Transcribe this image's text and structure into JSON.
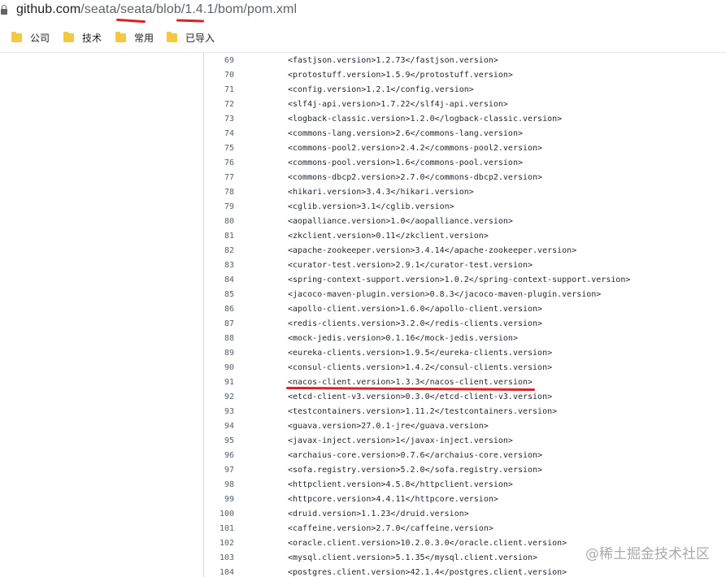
{
  "browser": {
    "url_host": "github.com",
    "url_path": "/seata/seata/blob/1.4.1/bom/pom.xml"
  },
  "bookmarks": [
    {
      "label": "公司"
    },
    {
      "label": "技术"
    },
    {
      "label": "常用"
    },
    {
      "label": "已导入"
    }
  ],
  "code_lines": [
    {
      "num": "69",
      "text": "<fastjson.version>1.2.73</fastjson.version>"
    },
    {
      "num": "70",
      "text": "<protostuff.version>1.5.9</protostuff.version>"
    },
    {
      "num": "71",
      "text": "<config.version>1.2.1</config.version>"
    },
    {
      "num": "72",
      "text": "<slf4j-api.version>1.7.22</slf4j-api.version>"
    },
    {
      "num": "73",
      "text": "<logback-classic.version>1.2.0</logback-classic.version>"
    },
    {
      "num": "74",
      "text": "<commons-lang.version>2.6</commons-lang.version>"
    },
    {
      "num": "75",
      "text": "<commons-pool2.version>2.4.2</commons-pool2.version>"
    },
    {
      "num": "76",
      "text": "<commons-pool.version>1.6</commons-pool.version>"
    },
    {
      "num": "77",
      "text": "<commons-dbcp2.version>2.7.0</commons-dbcp2.version>"
    },
    {
      "num": "78",
      "text": "<hikari.version>3.4.3</hikari.version>"
    },
    {
      "num": "79",
      "text": "<cglib.version>3.1</cglib.version>"
    },
    {
      "num": "80",
      "text": "<aopalliance.version>1.0</aopalliance.version>"
    },
    {
      "num": "81",
      "text": "<zkclient.version>0.11</zkclient.version>"
    },
    {
      "num": "82",
      "text": "<apache-zookeeper.version>3.4.14</apache-zookeeper.version>"
    },
    {
      "num": "83",
      "text": "<curator-test.version>2.9.1</curator-test.version>"
    },
    {
      "num": "84",
      "text": "<spring-context-support.version>1.0.2</spring-context-support.version>"
    },
    {
      "num": "85",
      "text": "<jacoco-maven-plugin.version>0.8.3</jacoco-maven-plugin.version>"
    },
    {
      "num": "86",
      "text": "<apollo-client.version>1.6.0</apollo-client.version>"
    },
    {
      "num": "87",
      "text": "<redis-clients.version>3.2.0</redis-clients.version>"
    },
    {
      "num": "88",
      "text": "<mock-jedis.version>0.1.16</mock-jedis.version>"
    },
    {
      "num": "89",
      "text": "<eureka-clients.version>1.9.5</eureka-clients.version>"
    },
    {
      "num": "90",
      "text": "<consul-clients.version>1.4.2</consul-clients.version>"
    },
    {
      "num": "91",
      "text": "<nacos-client.version>1.3.3</nacos-client.version>"
    },
    {
      "num": "92",
      "text": "<etcd-client-v3.version>0.3.0</etcd-client-v3.version>"
    },
    {
      "num": "93",
      "text": "<testcontainers.version>1.11.2</testcontainers.version>"
    },
    {
      "num": "94",
      "text": "<guava.version>27.0.1-jre</guava.version>"
    },
    {
      "num": "95",
      "text": "<javax-inject.version>1</javax-inject.version>"
    },
    {
      "num": "96",
      "text": "<archaius-core.version>0.7.6</archaius-core.version>"
    },
    {
      "num": "97",
      "text": "<sofa.registry.version>5.2.0</sofa.registry.version>"
    },
    {
      "num": "98",
      "text": "<httpclient.version>4.5.8</httpclient.version>"
    },
    {
      "num": "99",
      "text": "<httpcore.version>4.4.11</httpcore.version>"
    },
    {
      "num": "100",
      "text": "<druid.version>1.1.23</druid.version>"
    },
    {
      "num": "101",
      "text": "<caffeine.version>2.7.0</caffeine.version>"
    },
    {
      "num": "102",
      "text": "<oracle.client.version>10.2.0.3.0</oracle.client.version>"
    },
    {
      "num": "103",
      "text": "<mysql.client.version>5.1.35</mysql.client.version>"
    },
    {
      "num": "104",
      "text": "<postgres.client.version>42.1.4</postgres.client.version>"
    }
  ],
  "watermark": "@稀土掘金技术社区",
  "colors": {
    "annotation": "#e02020",
    "line_number": "#57606a",
    "code_text": "#24292f"
  }
}
